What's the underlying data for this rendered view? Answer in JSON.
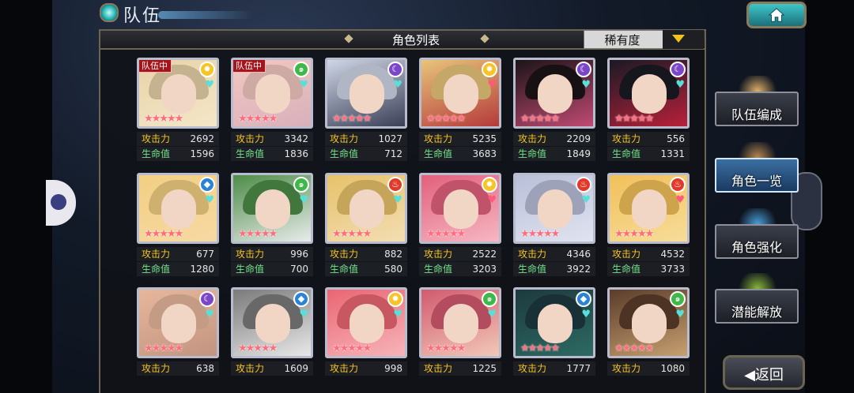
{
  "screen": {
    "title": "队伍",
    "home_icon": "home-icon"
  },
  "list": {
    "header_title": "角色列表",
    "sort": {
      "label": "稀有度",
      "arrow_icon": "triangle-down-icon"
    },
    "stat_labels": {
      "attack": "攻击力",
      "hp": "生命值"
    },
    "in_team_label": "队伍中",
    "rows": [
      [
        {
          "in_team": true,
          "attr": "light",
          "stars": 5,
          "attack": "2692",
          "hp": "1596"
        },
        {
          "in_team": true,
          "attr": "wind",
          "stars": 5,
          "attack": "3342",
          "hp": "1836"
        },
        {
          "in_team": false,
          "attr": "dark",
          "stars": 5,
          "attack": "1027",
          "hp": "712"
        },
        {
          "in_team": false,
          "attr": "light",
          "stars": 5,
          "attack": "5235",
          "hp": "3683"
        },
        {
          "in_team": false,
          "attr": "dark",
          "stars": 5,
          "attack": "2209",
          "hp": "1849"
        },
        {
          "in_team": false,
          "attr": "dark",
          "stars": 5,
          "attack": "556",
          "hp": "1331"
        }
      ],
      [
        {
          "in_team": false,
          "attr": "water",
          "stars": 5,
          "attack": "677",
          "hp": "1280"
        },
        {
          "in_team": false,
          "attr": "wind",
          "stars": 5,
          "attack": "996",
          "hp": "700"
        },
        {
          "in_team": false,
          "attr": "fire",
          "stars": 5,
          "attack": "882",
          "hp": "580"
        },
        {
          "in_team": false,
          "attr": "light",
          "stars": 5,
          "attack": "2522",
          "hp": "3203"
        },
        {
          "in_team": false,
          "attr": "fire",
          "stars": 5,
          "attack": "4346",
          "hp": "3922"
        },
        {
          "in_team": false,
          "attr": "fire",
          "stars": 5,
          "attack": "4532",
          "hp": "3733"
        }
      ],
      [
        {
          "in_team": false,
          "attr": "dark",
          "stars": 5,
          "attack": "638",
          "hp": ""
        },
        {
          "in_team": false,
          "attr": "water",
          "stars": 5,
          "attack": "1609",
          "hp": ""
        },
        {
          "in_team": false,
          "attr": "light",
          "stars": 5,
          "attack": "998",
          "hp": ""
        },
        {
          "in_team": false,
          "attr": "wind",
          "stars": 5,
          "attack": "1225",
          "hp": ""
        },
        {
          "in_team": false,
          "attr": "water",
          "stars": 5,
          "attack": "1777",
          "hp": ""
        },
        {
          "in_team": false,
          "attr": "wind",
          "stars": 5,
          "attack": "1080",
          "hp": ""
        }
      ]
    ]
  },
  "side_menu": [
    {
      "label": "队伍编成",
      "icon": "party-members-icon",
      "active": false
    },
    {
      "label": "角色一览",
      "icon": "book-icon",
      "active": true
    },
    {
      "label": "角色强化",
      "icon": "card-upgrade-icon",
      "active": false
    },
    {
      "label": "潜能解放",
      "icon": "potential-orb-icon",
      "active": false
    }
  ],
  "back_button": {
    "label": "返回",
    "icon": "back-arrow-icon"
  },
  "colors": {
    "attack_label": "#f3c322",
    "hp_label": "#75e38b",
    "team_badge": "#a5141a",
    "active_tab": "#3b6fa0",
    "sort_arrow": "#f2c21a"
  }
}
